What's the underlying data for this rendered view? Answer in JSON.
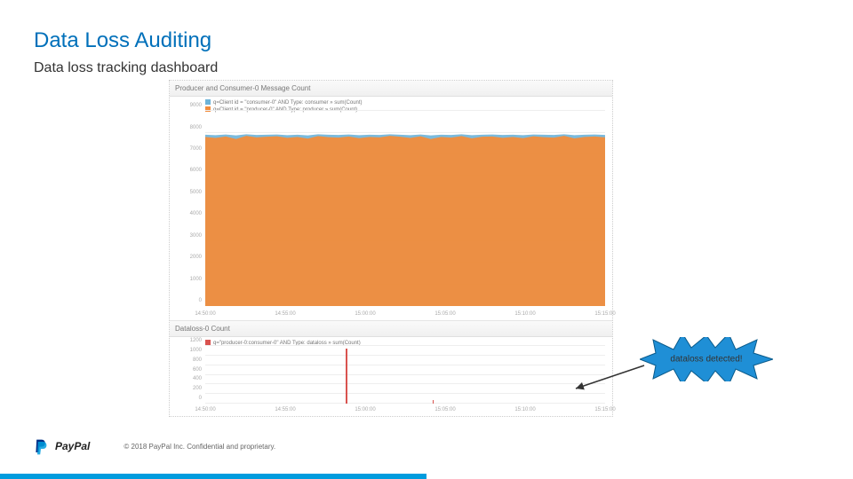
{
  "title": "Data Loss Auditing",
  "subtitle": "Data loss tracking dashboard",
  "callout": "dataloss detected!",
  "footer": {
    "brand": "PayPal",
    "copyright": "© 2018 PayPal Inc. Confidential and proprietary."
  },
  "colors": {
    "accent": "#009cde",
    "orange": "#f28c3b",
    "red": "#d9534f",
    "blue_series": "#6db3d8"
  },
  "chart_data": [
    {
      "type": "area",
      "title": "Producer and Consumer-0 Message Count",
      "series": [
        {
          "name": "q=Client id = \"consumer-0\" AND Type: consumer » sum(Count)",
          "color": "#6db3d8",
          "values": [
            7900,
            7880,
            7910,
            7870,
            7920,
            7890,
            7900,
            7910,
            7880,
            7900,
            7870,
            7920,
            7900,
            7890,
            7910,
            7880,
            7900,
            7890,
            7920,
            7900,
            7880,
            7910,
            7870,
            7900,
            7890,
            7920,
            7880,
            7900,
            7910,
            7890,
            7900,
            7880,
            7910,
            7900,
            7890,
            7920,
            7880,
            7900,
            7910,
            7890
          ]
        },
        {
          "name": "q=Client id = \"producer-0\" AND Type: producer » sum(Count)",
          "color": "#f28c3b",
          "values": [
            7800,
            7750,
            7820,
            7700,
            7850,
            7780,
            7810,
            7830,
            7760,
            7800,
            7720,
            7840,
            7790,
            7770,
            7820,
            7740,
            7800,
            7780,
            7850,
            7810,
            7750,
            7830,
            7700,
            7800,
            7770,
            7840,
            7730,
            7810,
            7820,
            7760,
            7800,
            7740,
            7830,
            7790,
            7770,
            7850,
            7730,
            7800,
            7820,
            7780
          ]
        }
      ],
      "x_categories": [
        "14:50:00",
        "14:55:00",
        "15:00:00",
        "15:05:00",
        "15:10:00",
        "15:15:00"
      ],
      "ylim": [
        0,
        9000
      ],
      "yticks": [
        0,
        1000,
        2000,
        3000,
        4000,
        5000,
        6000,
        7000,
        8000,
        9000
      ]
    },
    {
      "type": "bar",
      "title": "Dataloss-0 Count",
      "series": [
        {
          "name": "q=\"producer-0:consumer-0\" AND Type: dataloss » sum(Count)",
          "color": "#d9534f",
          "x": [
            14.98,
            15.07
          ],
          "values": [
            1150,
            80
          ]
        }
      ],
      "x_categories": [
        "14:50:00",
        "14:55:00",
        "15:00:00",
        "15:05:00",
        "15:10:00",
        "15:15:00"
      ],
      "ylim": [
        0,
        1200
      ],
      "yticks": [
        0,
        200,
        400,
        600,
        800,
        1000,
        1200
      ]
    }
  ]
}
